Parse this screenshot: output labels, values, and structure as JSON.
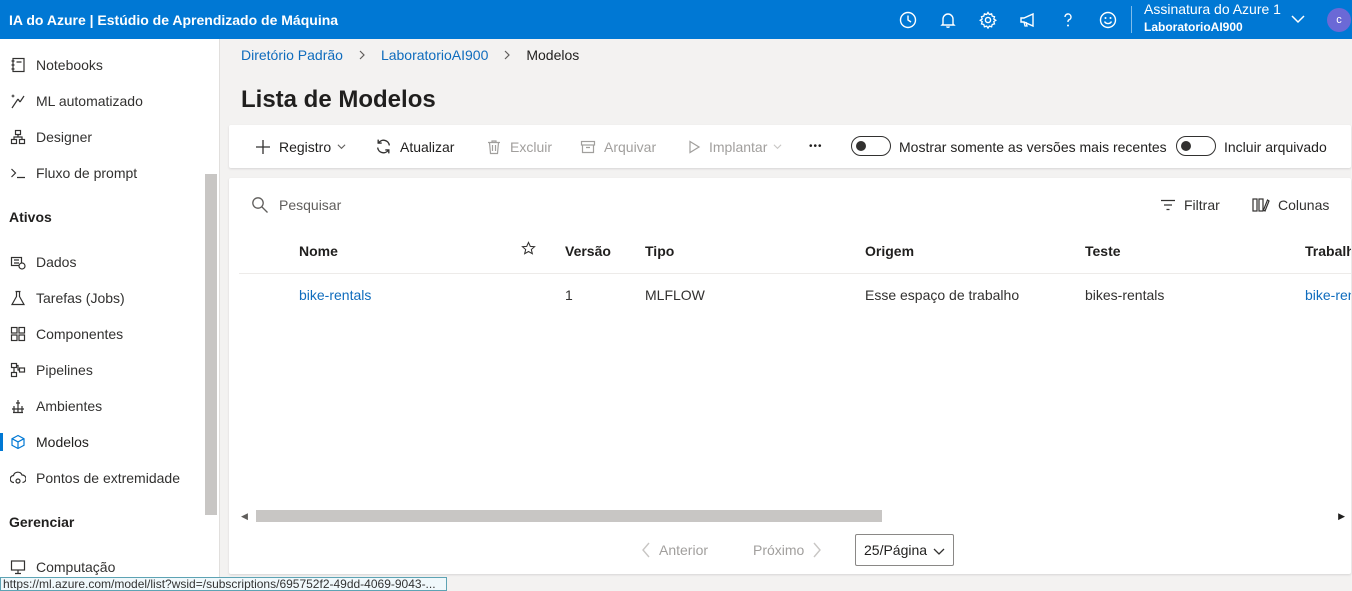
{
  "app": {
    "title": "IA do Azure | Estúdio de Aprendizado de Máquina",
    "header_icons": [
      "clock-icon",
      "bell-icon",
      "gear-icon",
      "megaphone-icon",
      "help-icon",
      "smiley-icon"
    ],
    "subscription": "Assinatura do Azure 1",
    "workspace": "LaboratorioAI900",
    "avatar_initial": "c",
    "brand_color": "#0078d4"
  },
  "sidebar": {
    "items_top": [
      {
        "label": "Notebooks",
        "icon": "notebook-icon"
      },
      {
        "label": "ML automatizado",
        "icon": "automl-icon"
      },
      {
        "label": "Designer",
        "icon": "designer-icon"
      },
      {
        "label": "Fluxo de prompt",
        "icon": "prompt-flow-icon"
      }
    ],
    "section_assets": "Ativos",
    "items_assets": [
      {
        "label": "Dados",
        "icon": "data-icon"
      },
      {
        "label": "Tarefas (Jobs)",
        "icon": "flask-icon"
      },
      {
        "label": "Componentes",
        "icon": "components-icon"
      },
      {
        "label": "Pipelines",
        "icon": "pipelines-icon"
      },
      {
        "label": "Ambientes",
        "icon": "environments-icon"
      },
      {
        "label": "Modelos",
        "icon": "cube-icon",
        "active": true
      },
      {
        "label": "Pontos de extremidade",
        "icon": "endpoint-icon"
      }
    ],
    "section_manage": "Gerenciar",
    "items_manage": [
      {
        "label": "Computação",
        "icon": "compute-icon"
      }
    ]
  },
  "breadcrumb": [
    "Diretório Padrão",
    "LaboratorioAI900",
    "Modelos"
  ],
  "page_title": "Lista de Modelos",
  "toolbar": {
    "register": "Registro",
    "refresh": "Atualizar",
    "delete": "Excluir",
    "archive": "Arquivar",
    "deploy": "Implantar",
    "more": "•••",
    "toggle_latest": "Mostrar somente as versões mais recentes",
    "toggle_archived": "Incluir arquivado"
  },
  "list": {
    "search_placeholder": "Pesquisar",
    "filter": "Filtrar",
    "columns": "Colunas",
    "headers": {
      "name": "Nome",
      "version": "Versão",
      "type": "Tipo",
      "origin": "Origem",
      "experiment": "Teste",
      "job": "Trabalh"
    },
    "rows": [
      {
        "name": "bike-rentals",
        "version": "1",
        "type": "MLFLOW",
        "origin": "Esse espaço de trabalho",
        "experiment": "bikes-rentals",
        "job": "bike-ren"
      }
    ]
  },
  "pagination": {
    "prev": "Anterior",
    "next": "Próximo",
    "page_size": "25/Página"
  },
  "status_url": "https://ml.azure.com/model/list?wsid=/subscriptions/695752f2-49dd-4069-9043-..."
}
